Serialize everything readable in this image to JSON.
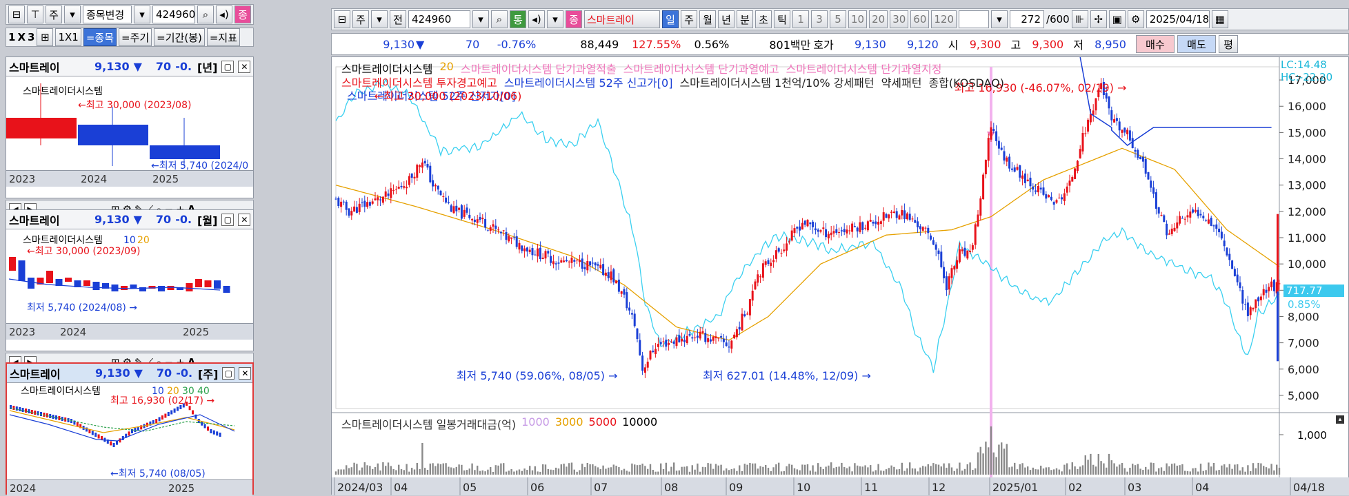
{
  "left_toolbar": {
    "market": "주",
    "action": "종목변경",
    "code": "424960",
    "tag": "종"
  },
  "left_tabs": [
    "1",
    "X",
    "3",
    "1X1",
    "=종목",
    "=주기",
    "=기간(봉)",
    "=지표"
  ],
  "panels": [
    {
      "name": "스마트레이",
      "price": "9,130",
      "arrow": "▼",
      "change": "70",
      "pct": "-0.",
      "period": "[년]",
      "legend": "스마트레이더시스템",
      "high_label": "←최고 30,000 (2023/08)",
      "low_label": "←최저 5,740 (2024/0",
      "axis": [
        "2023",
        "2024",
        "2025"
      ]
    },
    {
      "name": "스마트레이",
      "price": "9,130",
      "arrow": "▼",
      "change": "70",
      "pct": "-0.",
      "period": "[월]",
      "legend": "스마트레이더시스템",
      "ma": [
        "10",
        "20"
      ],
      "high_label": "←최고 30,000 (2023/09)",
      "low_label": "최저 5,740 (2024/08) →",
      "axis": [
        "2023",
        "2024",
        "2025"
      ]
    },
    {
      "name": "스마트레이",
      "price": "9,130",
      "arrow": "▼",
      "change": "70",
      "pct": "-0.",
      "period": "[주]",
      "legend": "스마트레이더시스템",
      "ma": [
        "10",
        "20",
        "30",
        "40"
      ],
      "high_label": "최고 16,930 (02/17) →",
      "low_label": "←최저 5,740 (08/05)",
      "axis": [
        "2024",
        "2025"
      ]
    }
  ],
  "main_toolbar": {
    "market": "주",
    "prev": "전",
    "code": "424960",
    "tong": "통",
    "jong": "종",
    "name": "스마트레이",
    "periods": [
      "일",
      "주",
      "월",
      "년",
      "분",
      "초",
      "틱"
    ],
    "minutes": [
      "1",
      "3",
      "5",
      "10",
      "20",
      "30",
      "60",
      "120"
    ],
    "count": "272",
    "max": "/600",
    "date": "2025/04/18"
  },
  "quote": {
    "price": "9,130",
    "arrow": "▼",
    "change": "70",
    "pct": "-0.76%",
    "volume": "88,449",
    "vol_ratio": "127.55%",
    "turnover": "0.56%",
    "amount": "801백만",
    "hoga_label": "호가",
    "ask": "9,130",
    "bid": "9,120",
    "open_label": "시",
    "open": "9,300",
    "high_label": "고",
    "high": "9,300",
    "low_label": "저",
    "low": "8,950",
    "buy": "매수",
    "sell": "매도",
    "flat": "평"
  },
  "legends": {
    "row1": [
      {
        "t": "스마트레이더시스템",
        "c": "#000"
      },
      {
        "t": "20",
        "c": "#e6a100"
      },
      {
        "t": "스마트레이더시스템 단기과열적출",
        "c": "#ee77bb"
      },
      {
        "t": "스마트레이더시스템 단기과열예고",
        "c": "#ee77bb"
      },
      {
        "t": "스마트레이더시스템 단기과열지정",
        "c": "#ee77bb"
      }
    ],
    "row2": [
      {
        "t": "스마트레이더시스템 투자경고예고",
        "c": "#e8121a"
      },
      {
        "t": "스마트레이더시스템 52주 신고가[0]",
        "c": "#1a3fd6"
      },
      {
        "t": "스마트레이더시스템 1천억/10% 강세패턴",
        "c": "#222"
      },
      {
        "t": "약세패턴",
        "c": "#222"
      },
      {
        "t": "종합(KOSDAQ)",
        "c": "#222"
      }
    ],
    "row3": {
      "t": "스마트레이더시스템 52주 신저가[0]",
      "c": "#1a3fd6"
    }
  },
  "annotations": {
    "high": "최고 16,930 (-46.07%, 02/19) →",
    "low1": "최저 5,740 (59.06%, 08/05) →",
    "low2": "최저 627.01 (14.48%, 12/09) →",
    "prev_high": "←최고 30,000 (2023/10/06)"
  },
  "right_axis": {
    "lc": "LC:14.48",
    "hc": "HC:-22.20",
    "box_value": "717.77",
    "box_pct": "0.85%",
    "volume_tick": "1,000"
  },
  "volume_legend": [
    {
      "t": "스마트레이더시스템 일봉거래대금(억)",
      "c": "#333"
    },
    {
      "t": "1000",
      "c": "#c79be6"
    },
    {
      "t": "3000",
      "c": "#e6a100"
    },
    {
      "t": "5000",
      "c": "#e8121a"
    },
    {
      "t": "10000",
      "c": "#000"
    }
  ],
  "chart_data": {
    "type": "candlestick",
    "ylim": [
      4500,
      17500
    ],
    "yticks": [
      5000,
      6000,
      7000,
      8000,
      9000,
      10000,
      11000,
      12000,
      13000,
      14000,
      15000,
      16000,
      17000
    ],
    "x_labels": [
      "2024/03",
      "04",
      "05",
      "06",
      "07",
      "08",
      "09",
      "10",
      "11",
      "12",
      "2025/01",
      "02",
      "03",
      "04",
      "04/18"
    ],
    "price_anchors": [
      [
        0,
        12400
      ],
      [
        5,
        12000
      ],
      [
        12,
        12300
      ],
      [
        20,
        12600
      ],
      [
        28,
        13200
      ],
      [
        33,
        14000
      ],
      [
        37,
        13000
      ],
      [
        45,
        12000
      ],
      [
        55,
        11700
      ],
      [
        65,
        11000
      ],
      [
        75,
        10500
      ],
      [
        85,
        10100
      ],
      [
        95,
        10000
      ],
      [
        105,
        9600
      ],
      [
        110,
        8700
      ],
      [
        114,
        7700
      ],
      [
        117,
        6000
      ],
      [
        122,
        6900
      ],
      [
        130,
        7100
      ],
      [
        138,
        7300
      ],
      [
        145,
        7100
      ],
      [
        150,
        6900
      ],
      [
        157,
        8300
      ],
      [
        160,
        9500
      ],
      [
        166,
        10200
      ],
      [
        172,
        10800
      ],
      [
        178,
        11600
      ],
      [
        186,
        11200
      ],
      [
        195,
        11300
      ],
      [
        205,
        11600
      ],
      [
        215,
        12000
      ],
      [
        222,
        11500
      ],
      [
        228,
        10900
      ],
      [
        233,
        9200
      ],
      [
        238,
        10400
      ],
      [
        242,
        10300
      ],
      [
        246,
        12500
      ],
      [
        250,
        15300
      ],
      [
        254,
        14200
      ],
      [
        258,
        13700
      ],
      [
        264,
        13200
      ],
      [
        270,
        12600
      ],
      [
        275,
        12300
      ],
      [
        280,
        13000
      ],
      [
        284,
        14500
      ],
      [
        288,
        15700
      ],
      [
        292,
        16900
      ],
      [
        296,
        15400
      ],
      [
        302,
        14900
      ],
      [
        306,
        14200
      ],
      [
        310,
        13300
      ],
      [
        314,
        11900
      ],
      [
        318,
        11100
      ],
      [
        322,
        11700
      ],
      [
        330,
        12000
      ],
      [
        336,
        11400
      ],
      [
        340,
        10500
      ],
      [
        344,
        9300
      ],
      [
        348,
        8100
      ],
      [
        352,
        8700
      ],
      [
        356,
        9200
      ],
      [
        360,
        9100
      ]
    ],
    "ma20_anchors": [
      [
        0,
        13000
      ],
      [
        30,
        12200
      ],
      [
        60,
        11300
      ],
      [
        90,
        10300
      ],
      [
        110,
        9200
      ],
      [
        130,
        7600
      ],
      [
        150,
        7100
      ],
      [
        165,
        8000
      ],
      [
        185,
        10000
      ],
      [
        210,
        11100
      ],
      [
        235,
        11300
      ],
      [
        250,
        11800
      ],
      [
        270,
        13200
      ],
      [
        285,
        13800
      ],
      [
        300,
        14400
      ],
      [
        320,
        13600
      ],
      [
        340,
        11300
      ],
      [
        360,
        9900
      ]
    ],
    "kosdaq_anchors": [
      [
        0,
        15400
      ],
      [
        8,
        16500
      ],
      [
        18,
        16900
      ],
      [
        28,
        16400
      ],
      [
        40,
        14300
      ],
      [
        55,
        14500
      ],
      [
        70,
        15700
      ],
      [
        80,
        14800
      ],
      [
        90,
        14500
      ],
      [
        100,
        15400
      ],
      [
        108,
        13000
      ],
      [
        114,
        11000
      ],
      [
        118,
        8500
      ],
      [
        124,
        6900
      ],
      [
        134,
        7400
      ],
      [
        146,
        8000
      ],
      [
        152,
        9300
      ],
      [
        158,
        10100
      ],
      [
        168,
        11100
      ],
      [
        178,
        10900
      ],
      [
        190,
        10500
      ],
      [
        205,
        10800
      ],
      [
        216,
        9000
      ],
      [
        222,
        7200
      ],
      [
        228,
        6000
      ],
      [
        234,
        8800
      ],
      [
        238,
        10700
      ],
      [
        246,
        10200
      ],
      [
        256,
        9400
      ],
      [
        264,
        8800
      ],
      [
        272,
        8500
      ],
      [
        282,
        9600
      ],
      [
        292,
        10800
      ],
      [
        300,
        11300
      ],
      [
        310,
        10400
      ],
      [
        320,
        10000
      ],
      [
        326,
        9700
      ],
      [
        334,
        9500
      ],
      [
        340,
        8500
      ],
      [
        345,
        7100
      ],
      [
        348,
        6400
      ],
      [
        352,
        8100
      ],
      [
        358,
        8600
      ],
      [
        360,
        8800
      ]
    ]
  }
}
